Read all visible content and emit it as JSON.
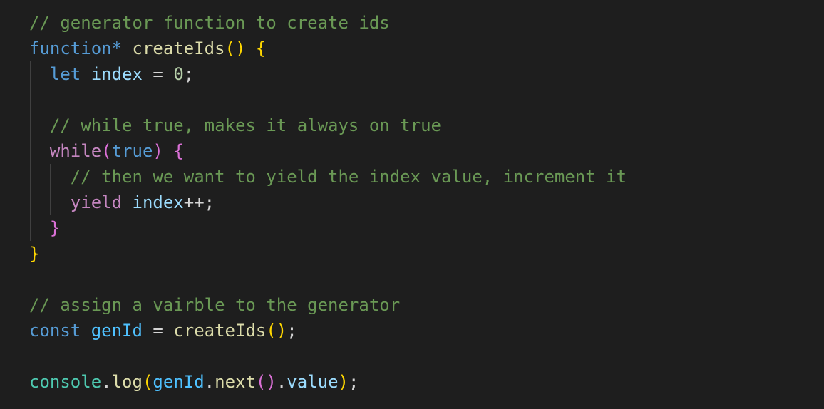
{
  "editor": {
    "lines": [
      {
        "tokens": [
          {
            "t": "// generator function to create ids",
            "c": "c-comment"
          }
        ]
      },
      {
        "tokens": [
          {
            "t": "function*",
            "c": "c-keyword"
          },
          {
            "t": " ",
            "c": "c-plain"
          },
          {
            "t": "createIds",
            "c": "c-func"
          },
          {
            "t": "()",
            "c": "b1"
          },
          {
            "t": " ",
            "c": "c-plain"
          },
          {
            "t": "{",
            "c": "b1"
          }
        ]
      },
      {
        "tokens": [
          {
            "t": "  ",
            "c": "c-plain"
          },
          {
            "t": "let",
            "c": "c-keyword"
          },
          {
            "t": " ",
            "c": "c-plain"
          },
          {
            "t": "index",
            "c": "c-var"
          },
          {
            "t": " = ",
            "c": "c-plain"
          },
          {
            "t": "0",
            "c": "c-number"
          },
          {
            "t": ";",
            "c": "c-plain"
          }
        ]
      },
      {
        "tokens": []
      },
      {
        "tokens": [
          {
            "t": "  ",
            "c": "c-plain"
          },
          {
            "t": "// while true, makes it always on true",
            "c": "c-comment"
          }
        ]
      },
      {
        "tokens": [
          {
            "t": "  ",
            "c": "c-plain"
          },
          {
            "t": "while",
            "c": "c-control"
          },
          {
            "t": "(",
            "c": "b2"
          },
          {
            "t": "true",
            "c": "c-keyword"
          },
          {
            "t": ")",
            "c": "b2"
          },
          {
            "t": " ",
            "c": "c-plain"
          },
          {
            "t": "{",
            "c": "b2"
          }
        ]
      },
      {
        "tokens": [
          {
            "t": "    ",
            "c": "c-plain"
          },
          {
            "t": "// then we want to yield the index value, increment it",
            "c": "c-comment"
          }
        ]
      },
      {
        "tokens": [
          {
            "t": "    ",
            "c": "c-plain"
          },
          {
            "t": "yield",
            "c": "c-control"
          },
          {
            "t": " ",
            "c": "c-plain"
          },
          {
            "t": "index",
            "c": "c-var"
          },
          {
            "t": "++;",
            "c": "c-plain"
          }
        ]
      },
      {
        "tokens": [
          {
            "t": "  ",
            "c": "c-plain"
          },
          {
            "t": "}",
            "c": "b2"
          }
        ]
      },
      {
        "tokens": [
          {
            "t": "}",
            "c": "b1"
          }
        ]
      },
      {
        "tokens": []
      },
      {
        "tokens": [
          {
            "t": "// assign a vairble to the generator",
            "c": "c-comment"
          }
        ]
      },
      {
        "tokens": [
          {
            "t": "const",
            "c": "c-keyword"
          },
          {
            "t": " ",
            "c": "c-plain"
          },
          {
            "t": "genId",
            "c": "c-const"
          },
          {
            "t": " = ",
            "c": "c-plain"
          },
          {
            "t": "createIds",
            "c": "c-func"
          },
          {
            "t": "()",
            "c": "b1"
          },
          {
            "t": ";",
            "c": "c-plain"
          }
        ]
      },
      {
        "tokens": []
      },
      {
        "tokens": [
          {
            "t": "console",
            "c": "c-type"
          },
          {
            "t": ".",
            "c": "c-plain"
          },
          {
            "t": "log",
            "c": "c-func"
          },
          {
            "t": "(",
            "c": "b1"
          },
          {
            "t": "genId",
            "c": "c-const"
          },
          {
            "t": ".",
            "c": "c-plain"
          },
          {
            "t": "next",
            "c": "c-func"
          },
          {
            "t": "()",
            "c": "b2"
          },
          {
            "t": ".",
            "c": "c-plain"
          },
          {
            "t": "value",
            "c": "c-var"
          },
          {
            "t": ")",
            "c": "b1"
          },
          {
            "t": ";",
            "c": "c-plain"
          }
        ]
      }
    ]
  },
  "theme": {
    "background": "#1e1e1e",
    "comment": "#6a9955",
    "keyword": "#569cd6",
    "control": "#c586c0",
    "function": "#dcdcaa",
    "variable": "#9cdcfe",
    "constant": "#4fc1ff",
    "number": "#b5cea8",
    "type": "#4ec9b0",
    "bracket_level_1": "#ffd700",
    "bracket_level_2": "#da70d6"
  }
}
